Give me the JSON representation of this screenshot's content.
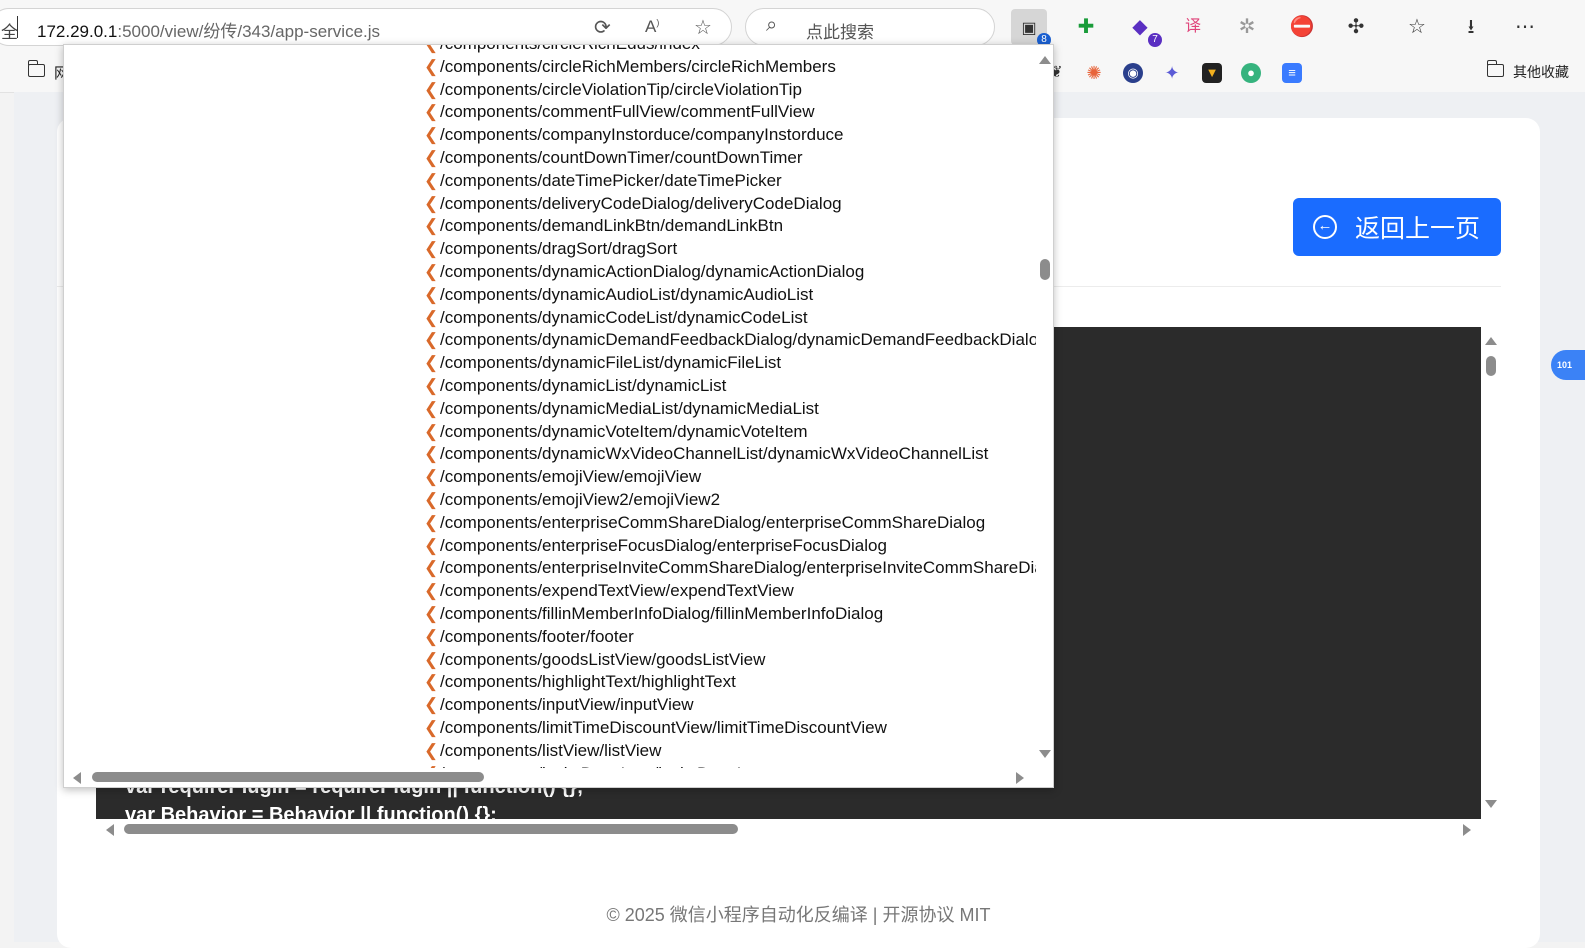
{
  "browser": {
    "address_prefix": "全",
    "url_host": "172.29.0.1",
    "url_path": ":5000/view/纷传/343/app-service.js",
    "search_placeholder": "点此搜索",
    "extension_badge": "8",
    "purple_ext_badge": "7",
    "bookmark_first": "网",
    "bookmark_folder_other": "其他收藏"
  },
  "page": {
    "back_button_label": "返回上一页",
    "back_icon": "arrow-left-circle-icon",
    "code_lines": [
      "var requirePlugin = requirePlugin || function() {};",
      "var Behavior = Behavior || function() {};"
    ],
    "footer": "© 2025 微信小程序自动化反编译 | 开源协议 MIT",
    "side_tab": "101"
  },
  "dropdown": {
    "items": [
      "/components/circleRichEdus/index",
      "/components/circleRichMembers/circleRichMembers",
      "/components/circleViolationTip/circleViolationTip",
      "/components/commentFullView/commentFullView",
      "/components/companyInstorduce/companyInstorduce",
      "/components/countDownTimer/countDownTimer",
      "/components/dateTimePicker/dateTimePicker",
      "/components/deliveryCodeDialog/deliveryCodeDialog",
      "/components/demandLinkBtn/demandLinkBtn",
      "/components/dragSort/dragSort",
      "/components/dynamicActionDialog/dynamicActionDialog",
      "/components/dynamicAudioList/dynamicAudioList",
      "/components/dynamicCodeList/dynamicCodeList",
      "/components/dynamicDemandFeedbackDialog/dynamicDemandFeedbackDialog",
      "/components/dynamicFileList/dynamicFileList",
      "/components/dynamicList/dynamicList",
      "/components/dynamicMediaList/dynamicMediaList",
      "/components/dynamicVoteItem/dynamicVoteItem",
      "/components/dynamicWxVideoChannelList/dynamicWxVideoChannelList",
      "/components/emojiView/emojiView",
      "/components/emojiView2/emojiView2",
      "/components/enterpriseCommShareDialog/enterpriseCommShareDialog",
      "/components/enterpriseFocusDialog/enterpriseFocusDialog",
      "/components/enterpriseInviteCommShareDialog/enterpriseInviteCommShareDialog",
      "/components/expendTextView/expendTextView",
      "/components/fillinMemberInfoDialog/fillinMemberInfoDialog",
      "/components/footer/footer",
      "/components/goodsListView/goodsListView",
      "/components/highlightText/highlightText",
      "/components/inputView/inputView",
      "/components/limitTimeDiscountView/limitTimeDiscountView",
      "/components/listView/listView",
      "/components/luckyDrawItem/luckyDrawItem"
    ]
  },
  "colors": {
    "accent": "#1a6cff",
    "code_bg": "#2b2b2b",
    "chevron": "#d9692a"
  }
}
